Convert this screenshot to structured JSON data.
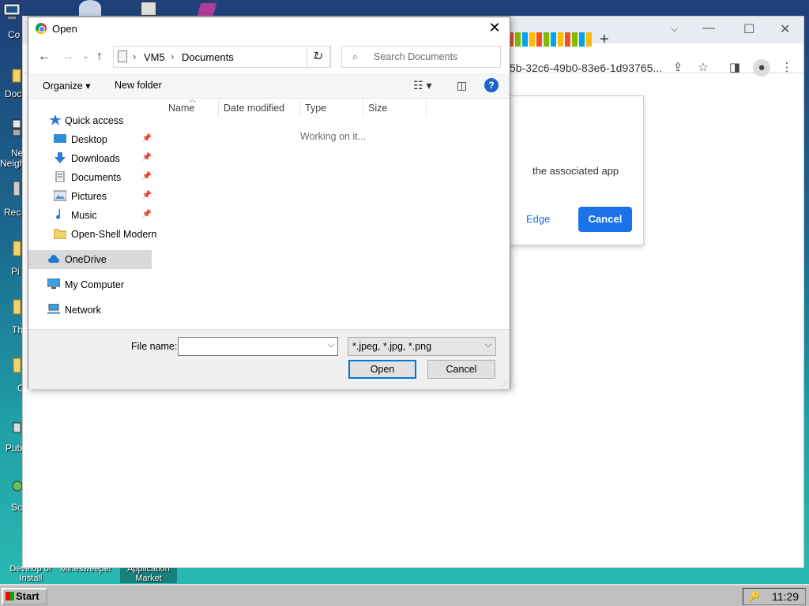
{
  "desktop": {
    "icons": [
      {
        "label": "Co"
      },
      {
        "label": "Doc"
      },
      {
        "label": "Ne"
      },
      {
        "label": "Neigh"
      },
      {
        "label": "Rec"
      },
      {
        "label": "Pi"
      },
      {
        "label": "Th"
      },
      {
        "label": "C"
      },
      {
        "label": "Pub"
      },
      {
        "label": "Sc"
      }
    ],
    "bottom_labels": [
      "Develop or Install",
      "Minesweeper",
      "Application Market"
    ]
  },
  "browser": {
    "url_fragment": "5b-32c6-49b0-83e6-1d93765...",
    "new_tab_symbol": "+",
    "edge_prompt": {
      "description": "the associated app",
      "open_edge_label": "Edge",
      "cancel_label": "Cancel"
    }
  },
  "dialog": {
    "title": "Open",
    "path": [
      "VM5",
      "Documents"
    ],
    "search_placeholder": "Search Documents",
    "toolbar": {
      "organize": "Organize",
      "new_folder": "New folder"
    },
    "nav": {
      "quick_access": "Quick access",
      "items": [
        {
          "label": "Desktop"
        },
        {
          "label": "Downloads"
        },
        {
          "label": "Documents"
        },
        {
          "label": "Pictures"
        },
        {
          "label": "Music"
        },
        {
          "label": "Open-Shell Modern"
        }
      ],
      "onedrive": "OneDrive",
      "my_computer": "My Computer",
      "network": "Network"
    },
    "columns": [
      "Name",
      "Date modified",
      "Type",
      "Size"
    ],
    "status": "Working on it...",
    "file_name_label": "File name:",
    "file_name_value": "",
    "file_type": "*.jpeg, *.jpg, *.png",
    "open_button": "Open",
    "cancel_button": "Cancel"
  },
  "taskbar": {
    "start": "Start",
    "clock": "11:29"
  }
}
